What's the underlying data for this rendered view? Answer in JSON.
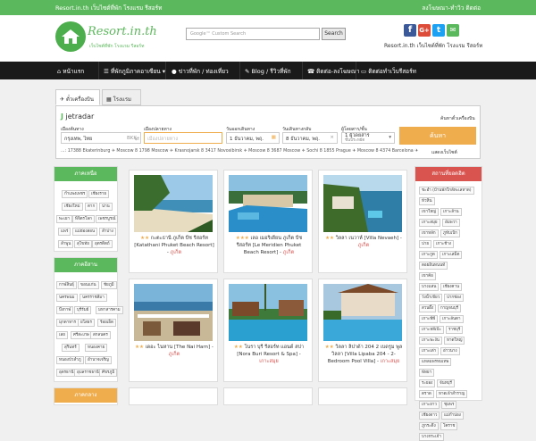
{
  "topbar": {
    "left_text": "Resort.in.th เว็บไซต์ที่พัก โรงแรม รีสอร์ท",
    "right_text": "ลงโฆษณา-ทำวิว ติดต่อ"
  },
  "logo": {
    "title": "Resort.in.th",
    "sub": "เว็บไซต์ที่พัก โรงแรม รีสอร์ท"
  },
  "search": {
    "placeholder": "Google™ Custom Search",
    "button": "Search"
  },
  "tagline": "Resort.in.th เว็บไซต์ที่พัก โรงแรม รีสอร์ท",
  "social": [
    {
      "name": "facebook-icon",
      "color": "#3b5998",
      "glyph": "f"
    },
    {
      "name": "google-plus-icon",
      "color": "#dd4b39",
      "glyph": "G+"
    },
    {
      "name": "twitter-icon",
      "color": "#1da1f2",
      "glyph": "t"
    },
    {
      "name": "email-icon",
      "color": "#5cb85c",
      "glyph": "✉"
    }
  ],
  "nav": [
    {
      "label": "หน้าแรก",
      "icon": "home-icon"
    },
    {
      "label": "ที่พักภูมิภาคอาเซียน",
      "icon": "list-icon"
    },
    {
      "label": "ข่าวที่พัก / ท่องเที่ยว",
      "icon": "chat-icon"
    },
    {
      "label": "Blog / รีวิวที่พัก",
      "icon": "pencil-icon"
    },
    {
      "label": "ติดต่อ-ลงโฆษณา",
      "icon": "phone-icon"
    },
    {
      "label": "ติดต่อทำเว็บรีสอร์ท",
      "icon": "monitor-icon"
    }
  ],
  "booking": {
    "tabs": [
      "ตั๋วเครื่องบิน",
      "โรงแรม"
    ],
    "brand": "jetradar",
    "top_right": "ค้นหาตั๋วเครื่องบิน",
    "from_label": "เมืองต้นทาง",
    "from_value": "กรุงเทพ, ไทย",
    "from_code": "BKK",
    "to_label": "เมืองปลายทาง",
    "to_placeholder": "เมืองปลายทาง",
    "depart_label": "วันออกเดินทาง",
    "depart_value": "1 ธันวาคม, พฤ.",
    "return_label": "วันเดินทางกลับ",
    "return_value": "8 ธันวาคม, พฤ.",
    "pax_label": "ผู้โดยสาร/ชั้น",
    "pax_value": "1 ผู้โดยสาร",
    "pax_class": "ชั้นประหยัด",
    "search_btn": "ค้นหา",
    "routes": "...: 17388   Ekaterinburg ✈ Moscow 8 1798   Moscow ✈ Krasnojarsk 8 3417   Novosibirsk ✈ Moscow 8 3687   Moscow ✈ Sochi 8 1855   Prague ✈ Moscow 8 4374   Barcelona ✈",
    "routes_right": "แสดงเว็บไซต์"
  },
  "left_sidebar": {
    "box1": {
      "title": "ภาคเหนือ",
      "tags": [
        "กำแพงเพชร",
        "เชียงราย",
        "เชียงใหม่",
        "ตาก",
        "น่าน",
        "พะเยา",
        "พิจิตรโลก",
        "เพชรบูรณ์",
        "แพร่",
        "แม่ฮ่องสอน",
        "ลำปาง",
        "ลำพูน",
        "สุโขทัย",
        "อุตรดิตถ์"
      ]
    },
    "box2": {
      "title": "ภาคอีสาน",
      "tags": [
        "กาฬสินธุ์",
        "ขอนแก่น",
        "ชัยภูมิ",
        "นครพนม",
        "นครราชสีมา",
        "บึงกาฬ",
        "บุรีรัมย์",
        "มหาสารคาม",
        "มุกดาหาร",
        "ยโสธร",
        "ร้อยเอ็ด",
        "เลย",
        "ศรีสะเกษ",
        "สกลนคร",
        "สุรินทร์",
        "หนองคาย",
        "หนองบัวลำภู",
        "อำนาจเจริญ",
        "อุดรธานี",
        "อุบลราชธานี",
        "ศีขรภูมิ"
      ]
    },
    "box3": {
      "title": "ภาคกลาง"
    }
  },
  "cards": [
    {
      "name": "กะตะธานี ภูเก็ต บีช รีสอร์ท [Katathani Phuket Beach Resort]",
      "location": "ภูเก็ต",
      "img": "beach"
    },
    {
      "name": "เลอ เมอริเดียน ภูเก็ต บีช รีสอร์ท [Le Meridien Phuket Beach Resort]",
      "location": "ภูเก็ต",
      "img": "pool"
    },
    {
      "name": "วิลลา เนวาห์ [Villa Nevaeh]",
      "location": "ภูเก็ต",
      "img": "cliff"
    },
    {
      "name": "เดอะ ไนหาน [The Nai Harn]",
      "location": "ภูเก็ต",
      "img": "terrace"
    },
    {
      "name": "โนรา บุรี รีสอร์ท แอนด์ สปา [Nora Buri Resort & Spa]",
      "location": "เกาะสมุย",
      "img": "pool2"
    },
    {
      "name": "วิลลา ลิปาด้า 204 2 เบดรูม พูล วิลลา [Villa Lipaba 204 - 2-Bedroom Pool Villa]",
      "location": "เกาะสมุย",
      "img": "villa"
    }
  ],
  "right_sidebar": {
    "title": "สถานที่ยอดฮิต",
    "tags": [
      "ชะอำ (บ้านพักใกล้ทะเลหาด)",
      "หัวหิน",
      "เขาใหญ่",
      "เกาะล้าน",
      "เกาะสมุย",
      "อัมพวา",
      "เขาหลัก",
      "ภูทับเบิก",
      "ปาย",
      "เกาะช้าง",
      "เกาะกูด",
      "เกาะเสม็ด",
      "ดอยอินทนนท์",
      "เขาค้อ",
      "บางแสน",
      "เชียงคาน",
      "วังน้ำเขียว",
      "ปากช่อง",
      "สวนผึ้ง",
      "กาญจนบุรี",
      "เกาะพีพี",
      "เกาะลันตา",
      "เกาะหลีเป๊ะ",
      "ราชบุรี",
      "เกาะพะงัน",
      "หาดใหญ่",
      "เกาะเต่า",
      "อ่าวนาง",
      "แหลมพรหมเทพ",
      "พัทยา",
      "ระยอง",
      "จันทบุรี",
      "ตราด",
      "หาดเจ้าสำราญ",
      "เกาะยาว",
      "ชุมพร",
      "เชียงดาว",
      "แม่กำปอง",
      "ภูกระดึง",
      "โคราช",
      "บางกระเจ้า"
    ]
  }
}
